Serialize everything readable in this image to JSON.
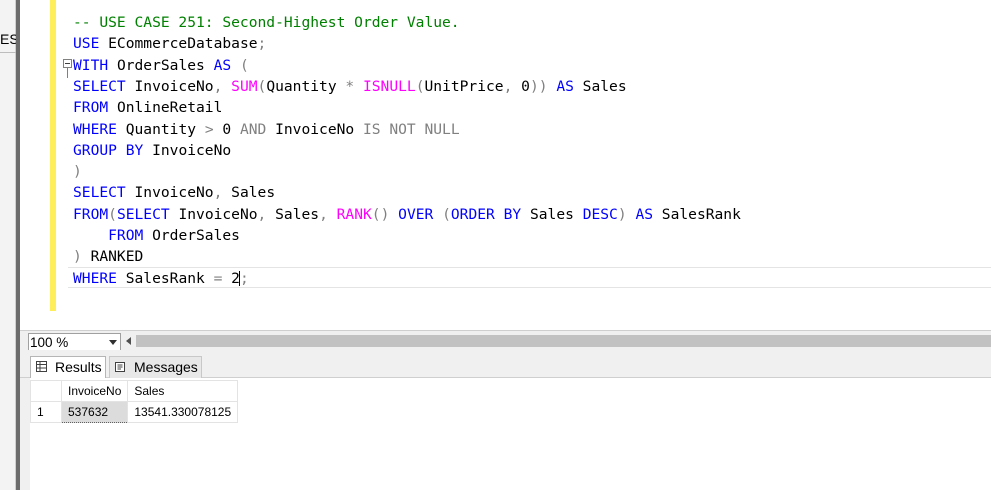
{
  "left_panel": {
    "cut_text": "ES"
  },
  "editor": {
    "lines": [
      [
        {
          "t": "-- USE CASE 251: Second-Highest Order Value.",
          "c": "cm"
        }
      ],
      [
        {
          "t": "USE",
          "c": "kw"
        },
        {
          "t": " ECommerceDatabase",
          "c": "tx"
        },
        {
          "t": ";",
          "c": "op"
        }
      ],
      [
        {
          "t": "WITH",
          "c": "kw"
        },
        {
          "t": " OrderSales ",
          "c": "tx"
        },
        {
          "t": "AS",
          "c": "kw"
        },
        {
          "t": " (",
          "c": "op"
        }
      ],
      [
        {
          "t": "SELECT",
          "c": "kw"
        },
        {
          "t": " InvoiceNo",
          "c": "tx"
        },
        {
          "t": ", ",
          "c": "op"
        },
        {
          "t": "SUM",
          "c": "fn"
        },
        {
          "t": "(",
          "c": "op"
        },
        {
          "t": "Quantity ",
          "c": "tx"
        },
        {
          "t": "* ",
          "c": "op"
        },
        {
          "t": "ISNULL",
          "c": "fn"
        },
        {
          "t": "(",
          "c": "op"
        },
        {
          "t": "UnitPrice",
          "c": "tx"
        },
        {
          "t": ", ",
          "c": "op"
        },
        {
          "t": "0",
          "c": "tx"
        },
        {
          "t": ")) ",
          "c": "op"
        },
        {
          "t": "AS",
          "c": "kw"
        },
        {
          "t": " Sales",
          "c": "tx"
        }
      ],
      [
        {
          "t": "FROM",
          "c": "kw"
        },
        {
          "t": " OnlineRetail",
          "c": "tx"
        }
      ],
      [
        {
          "t": "WHERE",
          "c": "kw"
        },
        {
          "t": " Quantity ",
          "c": "tx"
        },
        {
          "t": "> ",
          "c": "op"
        },
        {
          "t": "0 ",
          "c": "tx"
        },
        {
          "t": "AND",
          "c": "op"
        },
        {
          "t": " InvoiceNo ",
          "c": "tx"
        },
        {
          "t": "IS NOT NULL",
          "c": "op"
        }
      ],
      [
        {
          "t": "GROUP BY",
          "c": "kw"
        },
        {
          "t": " InvoiceNo",
          "c": "tx"
        }
      ],
      [
        {
          "t": ")",
          "c": "op"
        }
      ],
      [
        {
          "t": "SELECT",
          "c": "kw"
        },
        {
          "t": " InvoiceNo",
          "c": "tx"
        },
        {
          "t": ", ",
          "c": "op"
        },
        {
          "t": "Sales",
          "c": "tx"
        }
      ],
      [
        {
          "t": "FROM",
          "c": "kw"
        },
        {
          "t": "(",
          "c": "op"
        },
        {
          "t": "SELECT",
          "c": "kw"
        },
        {
          "t": " InvoiceNo",
          "c": "tx"
        },
        {
          "t": ", ",
          "c": "op"
        },
        {
          "t": "Sales",
          "c": "tx"
        },
        {
          "t": ", ",
          "c": "op"
        },
        {
          "t": "RANK",
          "c": "fn"
        },
        {
          "t": "() ",
          "c": "op"
        },
        {
          "t": "OVER",
          "c": "kw"
        },
        {
          "t": " (",
          "c": "op"
        },
        {
          "t": "ORDER BY",
          "c": "kw"
        },
        {
          "t": " Sales ",
          "c": "tx"
        },
        {
          "t": "DESC",
          "c": "kw"
        },
        {
          "t": ") ",
          "c": "op"
        },
        {
          "t": "AS",
          "c": "kw"
        },
        {
          "t": " SalesRank",
          "c": "tx"
        }
      ],
      [
        {
          "t": "    FROM",
          "c": "kw"
        },
        {
          "t": " OrderSales",
          "c": "tx"
        }
      ],
      [
        {
          "t": ") ",
          "c": "op"
        },
        {
          "t": "RANKED",
          "c": "tx"
        }
      ],
      [
        {
          "t": "WHERE",
          "c": "kw"
        },
        {
          "t": " SalesRank ",
          "c": "tx"
        },
        {
          "t": "= ",
          "c": "op"
        },
        {
          "t": "2",
          "c": "tx"
        },
        {
          "t": "|CARET|",
          "c": "caret"
        },
        {
          "t": ";",
          "c": "op"
        }
      ]
    ],
    "colors": {
      "keyword": "#0000ff",
      "function": "#ff00ff",
      "operator": "#808080",
      "comment": "#008000",
      "change_marker": "#ffee5c"
    }
  },
  "status": {
    "zoom": "100 %"
  },
  "tabs": {
    "results": "Results",
    "messages": "Messages"
  },
  "results": {
    "columns": [
      "InvoiceNo",
      "Sales"
    ],
    "rows": [
      {
        "row_number": "1",
        "cells": [
          "537632",
          "13541.330078125"
        ]
      }
    ]
  }
}
